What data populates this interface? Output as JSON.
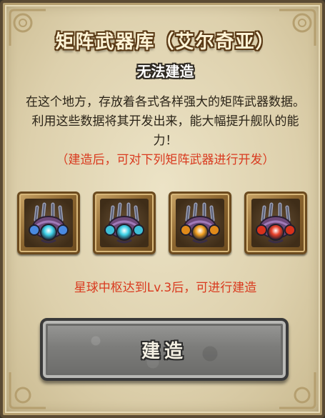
{
  "dialog": {
    "title": "矩阵武器库（艾尔奇亚）",
    "status": "无法建造",
    "description": "在这个地方，存放着各式各样强大的矩阵武器数据。利用这些数据将其开发出来，能大幅提升舰队的能力！",
    "note": "（建造后，可对下列矩阵武器进行开发）",
    "requirement": "星球中枢达到Lv.3后，可进行建造",
    "build_label": "建造"
  },
  "weapons": [
    {
      "icon": "matrix-weapon-icon",
      "core_color": "#3fd2e8",
      "side_color": "#4a8ae0"
    },
    {
      "icon": "matrix-weapon-icon",
      "core_color": "#3fd2e8",
      "side_color": "#3fc0d8"
    },
    {
      "icon": "matrix-weapon-icon",
      "core_color": "#f0a020",
      "side_color": "#e08a1a"
    },
    {
      "icon": "matrix-weapon-icon",
      "core_color": "#e8402a",
      "side_color": "#d8321c"
    }
  ],
  "colors": {
    "title_text": "#fff4d6",
    "note_red": "#d93a1f",
    "frame_brown": "#6b4a1e",
    "button_gray": "#7d7d7b"
  }
}
